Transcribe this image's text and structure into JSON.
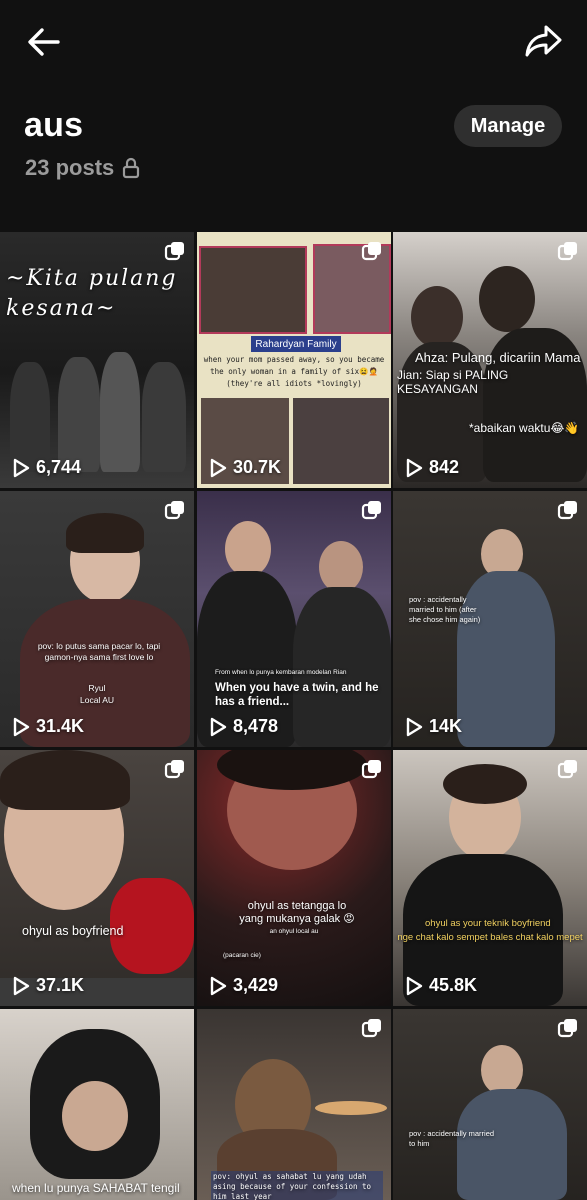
{
  "header": {
    "back_icon": "arrow-left-icon",
    "share_icon": "share-arrow-icon",
    "title": "aus",
    "posts_count": "23 posts",
    "lock_icon": "lock-icon",
    "manage_label": "Manage"
  },
  "tiles": [
    {
      "views": "6,744",
      "caption": "~Kita pulang kesana~"
    },
    {
      "views": "30.7K",
      "caption_title": "Rahardyan Family",
      "caption_body": "when your mom passed away, so you became the only woman in a family of six😫🤦 (they're all idiots *lovingly)"
    },
    {
      "views": "842",
      "caption_line1": "Ahza: Pulang, dicariin Mama",
      "caption_line2": "Jian: Siap si PALING KESAYANGAN",
      "caption_line3": "*abaikan waktu😂👋"
    },
    {
      "views": "31.4K",
      "caption": "pov: lo putus sama pacar lo, tapi gamon-nya sama first love lo",
      "subcaption_1": "Ryul",
      "subcaption_2": "Local AU"
    },
    {
      "views": "8,478",
      "caption_small": "From when lo punya kembaran modelan Rian",
      "caption": "When you have a twin, and he has a friend..."
    },
    {
      "views": "14K",
      "caption": "pov : accidentally married to him (after she chose him again)"
    },
    {
      "views": "37.1K",
      "caption": "ohyul as boyfriend"
    },
    {
      "views": "3,429",
      "caption": "ohyul as tetangga lo yang mukanya galak 😡",
      "subcaption_1": "an ohyul local au",
      "subcaption_2": "(pacaran cie)"
    },
    {
      "views": "45.8K",
      "caption_line1": "ohyul as your teknik boyfriend",
      "caption_line2": "nge chat kalo sempet bales chat kalo mepet"
    },
    {
      "caption": "when lu punya SAHABAT tengil"
    },
    {
      "caption": "pov: ohyul as sahabat lu yang udah asing because of your confession to him last year"
    },
    {
      "caption": "pov : accidentally married to him"
    }
  ]
}
